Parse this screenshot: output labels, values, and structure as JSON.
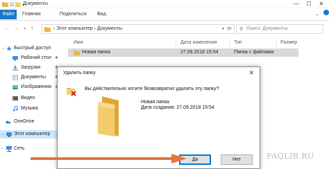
{
  "window": {
    "title": "Документы",
    "controls": [
      "minimize-icon",
      "maximize-icon",
      "close-icon"
    ]
  },
  "ribbon": {
    "file_tab": "Файл",
    "tabs": [
      "Главная",
      "Поделиться",
      "Вид"
    ],
    "accent": "#1979ca"
  },
  "address": {
    "path_root": "Этот компьютер",
    "path_folder": "Документы",
    "separator": "›",
    "search_placeholder": "Поиск: Документы"
  },
  "sidebar": {
    "items": [
      {
        "label": "Быстрый доступ",
        "icon": "star-icon",
        "pinned": false
      },
      {
        "label": "Рабочий стол",
        "icon": "desktop-icon",
        "pinned": true
      },
      {
        "label": "Загрузки",
        "icon": "downloads-icon",
        "pinned": true
      },
      {
        "label": "Документы",
        "icon": "documents-icon",
        "pinned": true
      },
      {
        "label": "Изображения",
        "icon": "pictures-icon",
        "pinned": true
      },
      {
        "label": "Видео",
        "icon": "video-icon",
        "pinned": false
      },
      {
        "label": "Музыка",
        "icon": "music-icon",
        "pinned": false
      },
      {
        "label": "OneDrive",
        "icon": "onedrive-icon",
        "pinned": false
      },
      {
        "label": "Этот компьютер",
        "icon": "computer-icon",
        "pinned": false,
        "selected": true
      },
      {
        "label": "Сеть",
        "icon": "network-icon",
        "pinned": false
      }
    ]
  },
  "file_list": {
    "columns": [
      "Имя",
      "Дата изменения",
      "Тип",
      "Размер"
    ],
    "rows": [
      {
        "name": "Новая папка",
        "modified": "27.09.2018 15:54",
        "type": "Папка с файлами",
        "size": ""
      }
    ]
  },
  "dialog": {
    "title": "Удалить папку",
    "question": "Вы действительно хотите безвозвратно удалить эту папку?",
    "folder_name": "Новая папка",
    "created_label": "Дата создания: 27.09.2018 15:54",
    "yes_label": "Да",
    "no_label": "Нет"
  },
  "annotation": {
    "arrow_color": "#e8763a"
  },
  "watermark": "FAQLIB.RU"
}
